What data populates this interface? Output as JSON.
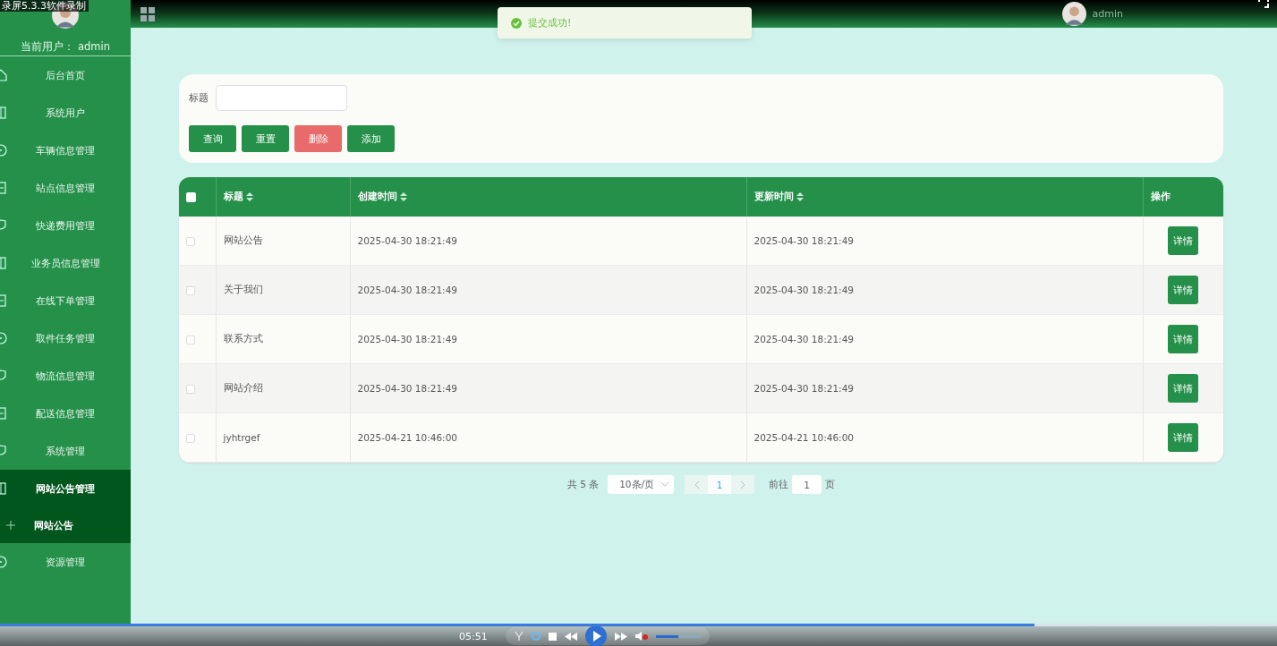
{
  "recorder_title": "录屏5.3.3软件录制",
  "sidebar": {
    "current_user_label": "当前用户：",
    "current_user": "admin",
    "items": [
      {
        "label": "后台首页",
        "selected": false
      },
      {
        "label": "系统用户",
        "selected": false
      },
      {
        "label": "车辆信息管理",
        "selected": false
      },
      {
        "label": "站点信息管理",
        "selected": false
      },
      {
        "label": "快递费用管理",
        "selected": false
      },
      {
        "label": "业务员信息管理",
        "selected": false
      },
      {
        "label": "在线下单管理",
        "selected": false
      },
      {
        "label": "取件任务管理",
        "selected": false
      },
      {
        "label": "物流信息管理",
        "selected": false
      },
      {
        "label": "配送信息管理",
        "selected": false
      },
      {
        "label": "系统管理",
        "selected": false
      },
      {
        "label": "网站公告管理",
        "selected": true,
        "expanded": true,
        "children": [
          {
            "label": "网站公告",
            "selected": true
          }
        ]
      },
      {
        "label": "资源管理",
        "selected": false
      }
    ]
  },
  "header": {
    "user": "admin"
  },
  "toast": {
    "kind": "success",
    "message": "提交成功!"
  },
  "search": {
    "label": "标题",
    "buttons": [
      {
        "label": "查询",
        "kind": "primary"
      },
      {
        "label": "重置",
        "kind": "primary"
      },
      {
        "label": "删除",
        "kind": "danger"
      },
      {
        "label": "添加",
        "kind": "primary"
      }
    ]
  },
  "table": {
    "all_checked": false,
    "columns": [
      {
        "label": "标题",
        "sortable": true
      },
      {
        "label": "创建时间",
        "sortable": true
      },
      {
        "label": "更新时间",
        "sortable": true
      },
      {
        "label": "操作",
        "sortable": false
      }
    ],
    "rows": [
      {
        "checked": false,
        "title": "网站公告",
        "created": "2025-04-30 18:21:49",
        "updated": "2025-04-30 18:21:49",
        "action": "详情"
      },
      {
        "checked": false,
        "title": "关于我们",
        "created": "2025-04-30 18:21:49",
        "updated": "2025-04-30 18:21:49",
        "action": "详情"
      },
      {
        "checked": false,
        "title": "联系方式",
        "created": "2025-04-30 18:21:49",
        "updated": "2025-04-30 18:21:49",
        "action": "详情"
      },
      {
        "checked": false,
        "title": "网站介绍",
        "created": "2025-04-30 18:21:49",
        "updated": "2025-04-30 18:21:49",
        "action": "详情"
      },
      {
        "checked": false,
        "title": "jyhtrgef",
        "created": "2025-04-21 10:46:00",
        "updated": "2025-04-21 10:46:00",
        "action": "详情"
      }
    ]
  },
  "pagination": {
    "total": "共 5 条",
    "page_size": "10条/页",
    "pages": [
      {
        "label": "1",
        "selected": true
      }
    ],
    "goto_label": "前往",
    "goto_value": "1",
    "goto_suffix": "页"
  },
  "player": {
    "time": "05:51",
    "level": 0.81,
    "volume": {
      "level": 0.5
    }
  }
}
